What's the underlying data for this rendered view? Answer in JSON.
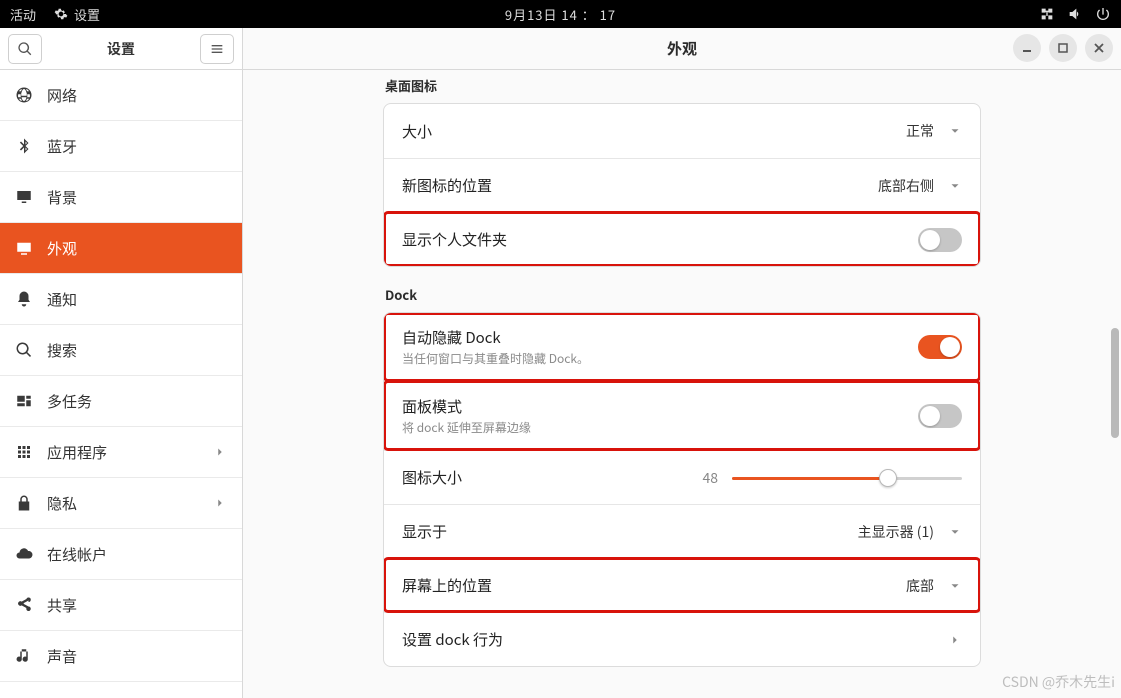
{
  "topbar": {
    "activities": "活动",
    "app_label": "设置",
    "datetime": "9月13日  14 ： 17"
  },
  "sidebar": {
    "title": "设置",
    "items": [
      {
        "id": "network",
        "label": "网络"
      },
      {
        "id": "bluetooth",
        "label": "蓝牙"
      },
      {
        "id": "background",
        "label": "背景"
      },
      {
        "id": "appearance",
        "label": "外观"
      },
      {
        "id": "notifications",
        "label": "通知"
      },
      {
        "id": "search",
        "label": "搜索"
      },
      {
        "id": "multitasking",
        "label": "多任务"
      },
      {
        "id": "applications",
        "label": "应用程序",
        "chevron": true
      },
      {
        "id": "privacy",
        "label": "隐私",
        "chevron": true
      },
      {
        "id": "online",
        "label": "在线帐户"
      },
      {
        "id": "sharing",
        "label": "共享"
      },
      {
        "id": "sound",
        "label": "声音"
      }
    ]
  },
  "content": {
    "title": "外观",
    "sections": {
      "desktop_icons": {
        "title": "桌面图标",
        "size_label": "大小",
        "size_value": "正常",
        "newpos_label": "新图标的位置",
        "newpos_value": "底部右侧",
        "show_home_label": "显示个人文件夹",
        "show_home_on": false
      },
      "dock": {
        "title": "Dock",
        "autohide_label": "自动隐藏 Dock",
        "autohide_sub": "当任何窗口与其重叠时隐藏 Dock。",
        "autohide_on": true,
        "panel_label": "面板模式",
        "panel_sub": "将 dock 延伸至屏幕边缘",
        "panel_on": false,
        "iconsize_label": "图标大小",
        "iconsize_value": "48",
        "iconsize_percent": 68,
        "showon_label": "显示于",
        "showon_value": "主显示器 (1)",
        "position_label": "屏幕上的位置",
        "position_value": "底部",
        "behavior_label": "设置 dock 行为"
      }
    }
  },
  "watermark": "CSDN @乔木先生i"
}
